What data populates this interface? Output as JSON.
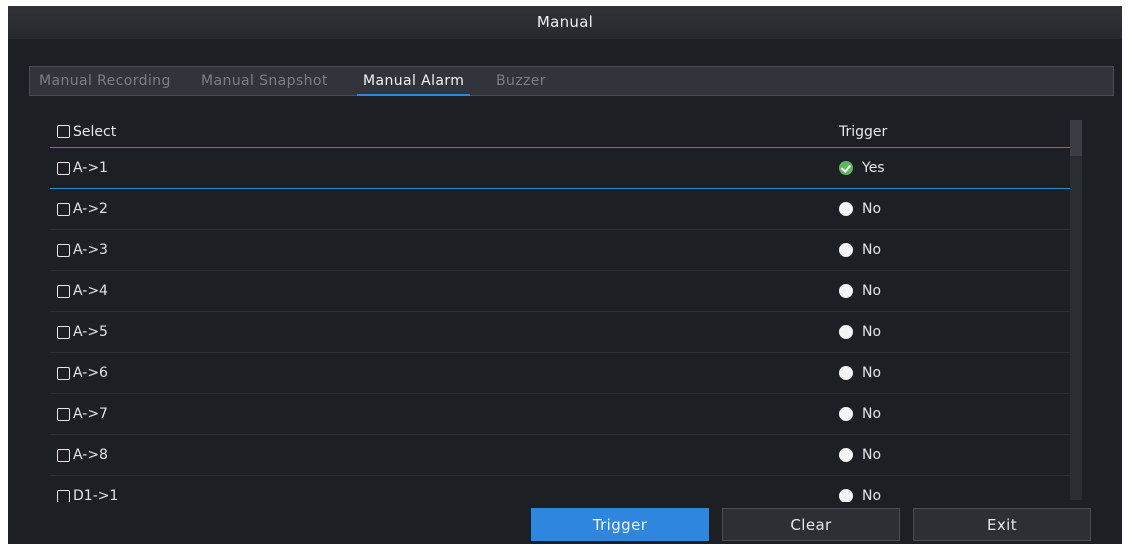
{
  "window": {
    "title": "Manual"
  },
  "tabs": [
    {
      "label": "Manual Recording",
      "active": false
    },
    {
      "label": "Manual Snapshot",
      "active": false
    },
    {
      "label": "Manual Alarm",
      "active": true
    },
    {
      "label": "Buzzer",
      "active": false
    }
  ],
  "table": {
    "columns": {
      "select": "Select",
      "trigger": "Trigger"
    },
    "rows": [
      {
        "name": "A->1",
        "trigger": "Yes",
        "checked": false
      },
      {
        "name": "A->2",
        "trigger": "No",
        "checked": false
      },
      {
        "name": "A->3",
        "trigger": "No",
        "checked": false
      },
      {
        "name": "A->4",
        "trigger": "No",
        "checked": false
      },
      {
        "name": "A->5",
        "trigger": "No",
        "checked": false
      },
      {
        "name": "A->6",
        "trigger": "No",
        "checked": false
      },
      {
        "name": "A->7",
        "trigger": "No",
        "checked": false
      },
      {
        "name": "A->8",
        "trigger": "No",
        "checked": false
      },
      {
        "name": "D1->1",
        "trigger": "No",
        "checked": false
      }
    ]
  },
  "buttons": {
    "trigger": "Trigger",
    "clear": "Clear",
    "exit": "Exit"
  },
  "colors": {
    "accent": "#2e86de",
    "background": "#1c1f24",
    "yes": "#5cb85c"
  },
  "icons": {
    "yes": "check-circle-icon",
    "no": "circle-icon",
    "checkbox": "checkbox-icon"
  }
}
